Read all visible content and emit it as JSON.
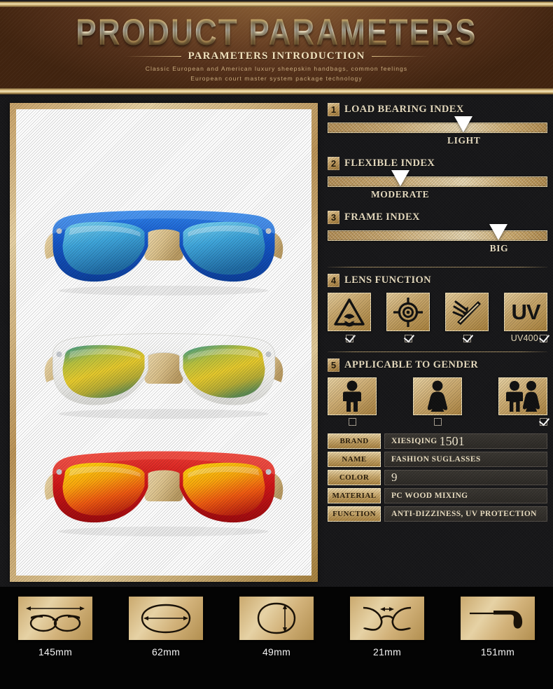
{
  "header": {
    "title": "PRODUCT PARAMETERS",
    "subtitle": "PARAMETERS  INTRODUCTION",
    "tagline_1": "Classic European and American luxury sheepskin handbags, common feelings",
    "tagline_2": "European court master system package technology"
  },
  "product_gallery": {
    "items": [
      {
        "name": "blue-wayfarer-sunglasses",
        "frame_color": "#1565d8",
        "lens_color": "#4fb8e8",
        "temple_color": "#e3c794"
      },
      {
        "name": "white-wayfarer-sunglasses",
        "frame_color": "#fbfbfb",
        "lens_color": "#cfc046",
        "temple_color": "#e3c794"
      },
      {
        "name": "red-wayfarer-sunglasses",
        "frame_color": "#d81f22",
        "lens_color": "#f3a211",
        "temple_color": "#e3c794"
      }
    ]
  },
  "index_sections": [
    {
      "number": "1",
      "title": "LOAD BEARING INDEX",
      "caption": "LIGHT",
      "marker_percent": 62
    },
    {
      "number": "2",
      "title": "FLEXIBLE INDEX",
      "caption": "MODERATE",
      "marker_percent": 33
    },
    {
      "number": "3",
      "title": "FRAME INDEX",
      "caption": "BIG",
      "marker_percent": 78
    }
  ],
  "lens_function": {
    "number": "4",
    "title": "LENS FUNCTION",
    "items": [
      {
        "icon": "radiation-hazard-icon",
        "label": "",
        "checked": true
      },
      {
        "icon": "crosshair-target-icon",
        "label": "",
        "checked": true
      },
      {
        "icon": "light-rays-lens-icon",
        "label": "",
        "checked": true
      },
      {
        "icon": "uv-text-icon",
        "label": "UV",
        "sub_label": "UV400",
        "checked": true
      }
    ]
  },
  "applicable_gender": {
    "number": "5",
    "title": "APPLICABLE TO GENDER",
    "items": [
      {
        "icon": "male-figure-icon",
        "checked": false
      },
      {
        "icon": "female-figure-icon",
        "checked": false
      },
      {
        "icon": "couple-figure-icon",
        "checked": true
      }
    ]
  },
  "spec_table": {
    "rows": [
      {
        "key": "BRAND",
        "value": "XIESIQING",
        "value_extra": "1501"
      },
      {
        "key": "NAME",
        "value": "FASHION SUGLASSES",
        "value_extra": ""
      },
      {
        "key": "COLOR",
        "value": "",
        "value_big": "9"
      },
      {
        "key": "MATERIAL",
        "value": "PC WOOD MIXING",
        "value_extra": ""
      },
      {
        "key": "FUNCTION",
        "value": "ANTI-DIZZINESS, UV PROTECTION",
        "value_extra": ""
      }
    ]
  },
  "measurements": [
    {
      "icon": "frame-width-icon",
      "label": "145mm"
    },
    {
      "icon": "lens-width-icon",
      "label": "62mm"
    },
    {
      "icon": "lens-height-icon",
      "label": "49mm"
    },
    {
      "icon": "bridge-width-icon",
      "label": "21mm"
    },
    {
      "icon": "temple-length-icon",
      "label": "151mm"
    }
  ],
  "colors": {
    "gold": "#c9a96d",
    "gold_light": "#f0e0b8",
    "dark_bg": "#18181a",
    "banner_brown": "#6e4526"
  }
}
